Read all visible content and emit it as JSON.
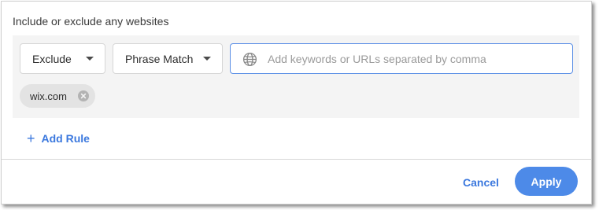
{
  "heading": "Include or exclude any websites",
  "rule": {
    "mode_select": {
      "value": "Exclude",
      "icon": "chevron-down-icon"
    },
    "match_select": {
      "value": "Phrase Match",
      "icon": "chevron-down-icon"
    },
    "keyword_input": {
      "value": "",
      "placeholder": "Add keywords or URLs separated by comma",
      "icon": "globe-icon"
    },
    "chips": [
      {
        "label": "wix.com",
        "remove_icon": "close-circle-icon"
      }
    ]
  },
  "add_rule_label": "Add Rule",
  "add_rule_icon": "plus-icon",
  "footer": {
    "cancel_label": "Cancel",
    "apply_label": "Apply"
  },
  "colors": {
    "accent": "#3b78de",
    "apply_button": "#4d8ae8",
    "panel_background": "#f4f4f4",
    "chip_background": "#e3e3e3",
    "input_focus_border": "#5b8fe6"
  }
}
